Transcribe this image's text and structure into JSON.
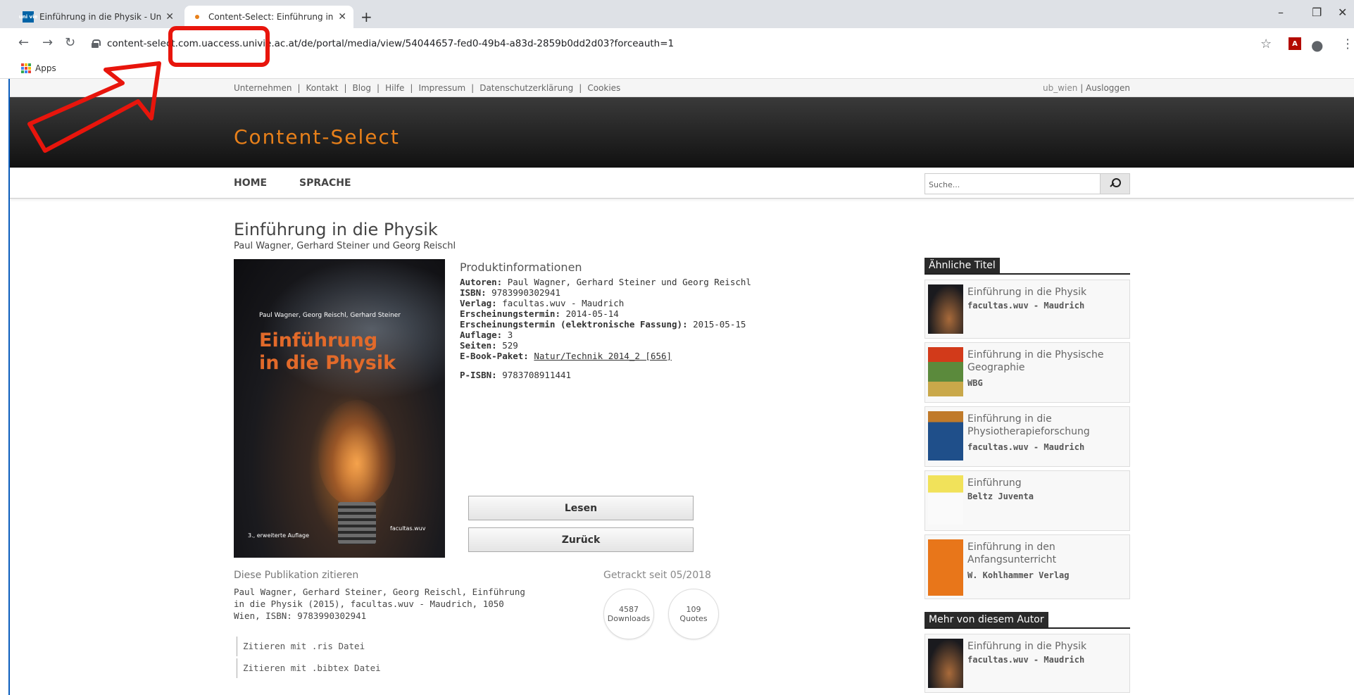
{
  "browser": {
    "tabs": [
      {
        "title": "Einführung in die Physik - Univer",
        "active": false,
        "favicon": "univie-icon"
      },
      {
        "title": "Content-Select: Einführung in die",
        "active": true,
        "favicon": "content-select-icon"
      }
    ],
    "url": "content-select.com.uaccess.univie.ac.at/de/portal/media/view/54044657-fed0-49b4-a83d-2859b0dd2d03?forceauth=1",
    "bookmarks": {
      "apps_label": "Apps"
    },
    "favicon_label": "uni vie"
  },
  "topnav": {
    "links": [
      "Unternehmen",
      "Kontakt",
      "Blog",
      "Hilfe",
      "Impressum",
      "Datenschutzerklärung",
      "Cookies"
    ],
    "user": "ub_wien",
    "logout": "Ausloggen"
  },
  "header": {
    "logo": "Content-Select",
    "logo_color": "#e8801a"
  },
  "mainnav": {
    "home": "HOME",
    "language": "SPRACHE",
    "search_placeholder": "Suche..."
  },
  "book": {
    "title": "Einführung in die Physik",
    "authors": "Paul Wagner, Gerhard Steiner und Georg Reischl",
    "cover": {
      "authors": "Paul Wagner, Georg Reischl, Gerhard Steiner",
      "title_line1": "Einführung",
      "title_line2": "in die Physik",
      "edition": "3., erweiterte Auflage",
      "publisher": "facultas.wuv"
    },
    "info_heading": "Produktinformationen",
    "info": {
      "autoren_label": "Autoren:",
      "autoren": "Paul Wagner, Gerhard Steiner und Georg Reischl",
      "isbn_label": "ISBN:",
      "isbn": "9783990302941",
      "verlag_label": "Verlag:",
      "verlag": "facultas.wuv - Maudrich",
      "termin_label": "Erscheinungstermin:",
      "termin": "2014-05-14",
      "etermin_label": "Erscheinungstermin (elektronische Fassung):",
      "etermin": "2015-05-15",
      "auflage_label": "Auflage:",
      "auflage": "3",
      "seiten_label": "Seiten:",
      "seiten": "529",
      "paket_label": "E-Book-Paket:",
      "paket": "Natur/Technik 2014_2 [656]",
      "pisbn_label": "P-ISBN:",
      "pisbn": "9783708911441"
    },
    "buttons": {
      "read": "Lesen",
      "back": "Zurück"
    }
  },
  "citation": {
    "heading": "Diese Publikation zitieren",
    "text": "Paul Wagner, Gerhard Steiner, Georg Reischl, Einführung in die Physik (2015), facultas.wuv - Maudrich, 1050 Wien, ISBN: 9783990302941",
    "ris": "Zitieren mit .ris Datei",
    "bibtex": "Zitieren mit .bibtex Datei"
  },
  "tracking": {
    "heading": "Getrackt seit 05/2018",
    "downloads_value": "4587",
    "downloads_label": "Downloads",
    "quotes_value": "109",
    "quotes_label": "Quotes"
  },
  "similar": {
    "heading": "Ähnliche Titel",
    "items": [
      {
        "title": "Einführung in die Physik",
        "publisher": "facultas.wuv - Maudrich"
      },
      {
        "title": "Einführung in die Physische Geographie",
        "publisher": "WBG"
      },
      {
        "title": "Einführung in die Physiotherapieforschung",
        "publisher": "facultas.wuv - Maudrich"
      },
      {
        "title": "Einführung",
        "publisher": "Beltz Juventa"
      },
      {
        "title": "Einführung in den Anfangsunterricht",
        "publisher": "W. Kohlhammer Verlag"
      }
    ]
  },
  "more_by_author": {
    "heading": "Mehr von diesem Autor",
    "items": [
      {
        "title": "Einführung in die Physik",
        "publisher": "facultas.wuv - Maudrich"
      }
    ]
  },
  "colors": {
    "annotation_red": "#e8150c",
    "accent_orange": "#e8801a"
  }
}
